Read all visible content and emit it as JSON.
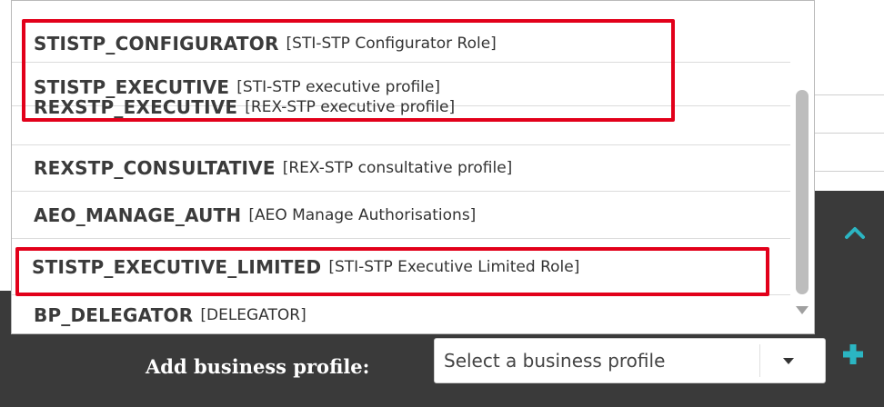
{
  "dropdown": {
    "items": [
      {
        "code": "STISTP_CONFIGURATOR",
        "desc": "[STI-STP Configurator Role]"
      },
      {
        "code": "STISTP_EXECUTIVE",
        "desc": "[STI-STP executive profile]"
      },
      {
        "code": "REXSTP_EXECUTIVE",
        "desc": "[REX-STP executive profile]"
      },
      {
        "code": "REXSTP_CONSULTATIVE",
        "desc": "[REX-STP consultative profile]"
      },
      {
        "code": "AEO_MANAGE_AUTH",
        "desc": "[AEO Manage Authorisations]"
      },
      {
        "code": "STISTP_EXECUTIVE_LIMITED",
        "desc": "[STI-STP Executive Limited Role]"
      },
      {
        "code": "BP_DELEGATOR",
        "desc": "[DELEGATOR]"
      }
    ]
  },
  "add_profile": {
    "label": "Add business profile:",
    "select_placeholder": "Select a business profile"
  },
  "icons": {
    "collapse": "chevron-up-icon",
    "add": "plus-icon",
    "dropdown_arrow": "caret-down-icon",
    "scroll_down": "triangle-down-icon"
  },
  "colors": {
    "highlight": "#e2001a",
    "accent": "#2bb5c2",
    "dark_panel": "#3a3a3a"
  }
}
